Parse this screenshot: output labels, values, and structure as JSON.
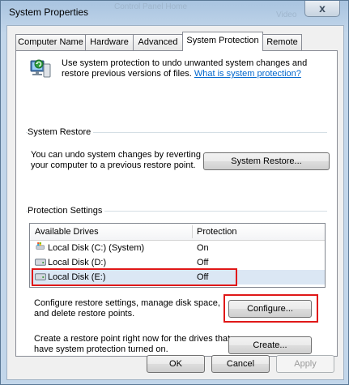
{
  "window": {
    "title": "System Properties",
    "background_hint": "Control Panel Home",
    "background_hint2": "Video",
    "close_glyph": "x"
  },
  "tabs": [
    {
      "label": "Computer Name"
    },
    {
      "label": "Hardware"
    },
    {
      "label": "Advanced"
    },
    {
      "label": "System Protection"
    },
    {
      "label": "Remote"
    }
  ],
  "intro": {
    "text": "Use system protection to undo unwanted system changes and restore previous versions of files.",
    "link": "What is system protection?"
  },
  "system_restore": {
    "group_label": "System Restore",
    "text": "You can undo system changes by reverting your computer to a previous restore point.",
    "button": "System Restore..."
  },
  "protection_settings": {
    "group_label": "Protection Settings",
    "columns": [
      "Available Drives",
      "Protection"
    ],
    "drives": [
      {
        "name": "Local Disk (C:) (System)",
        "protection": "On",
        "icon": "system-drive-icon"
      },
      {
        "name": "Local Disk (D:)",
        "protection": "Off",
        "icon": "drive-icon"
      },
      {
        "name": "Local Disk (E:)",
        "protection": "Off",
        "icon": "drive-icon",
        "selected": true
      }
    ],
    "configure_text": "Configure restore settings, manage disk space, and delete restore points.",
    "configure_button": "Configure...",
    "create_text": "Create a restore point right now for the drives that have system protection turned on.",
    "create_button": "Create..."
  },
  "footer": {
    "ok": "OK",
    "cancel": "Cancel",
    "apply": "Apply"
  },
  "colors": {
    "highlight": "#e01818",
    "link": "#0066cc",
    "selection": "#dbe7f4"
  }
}
